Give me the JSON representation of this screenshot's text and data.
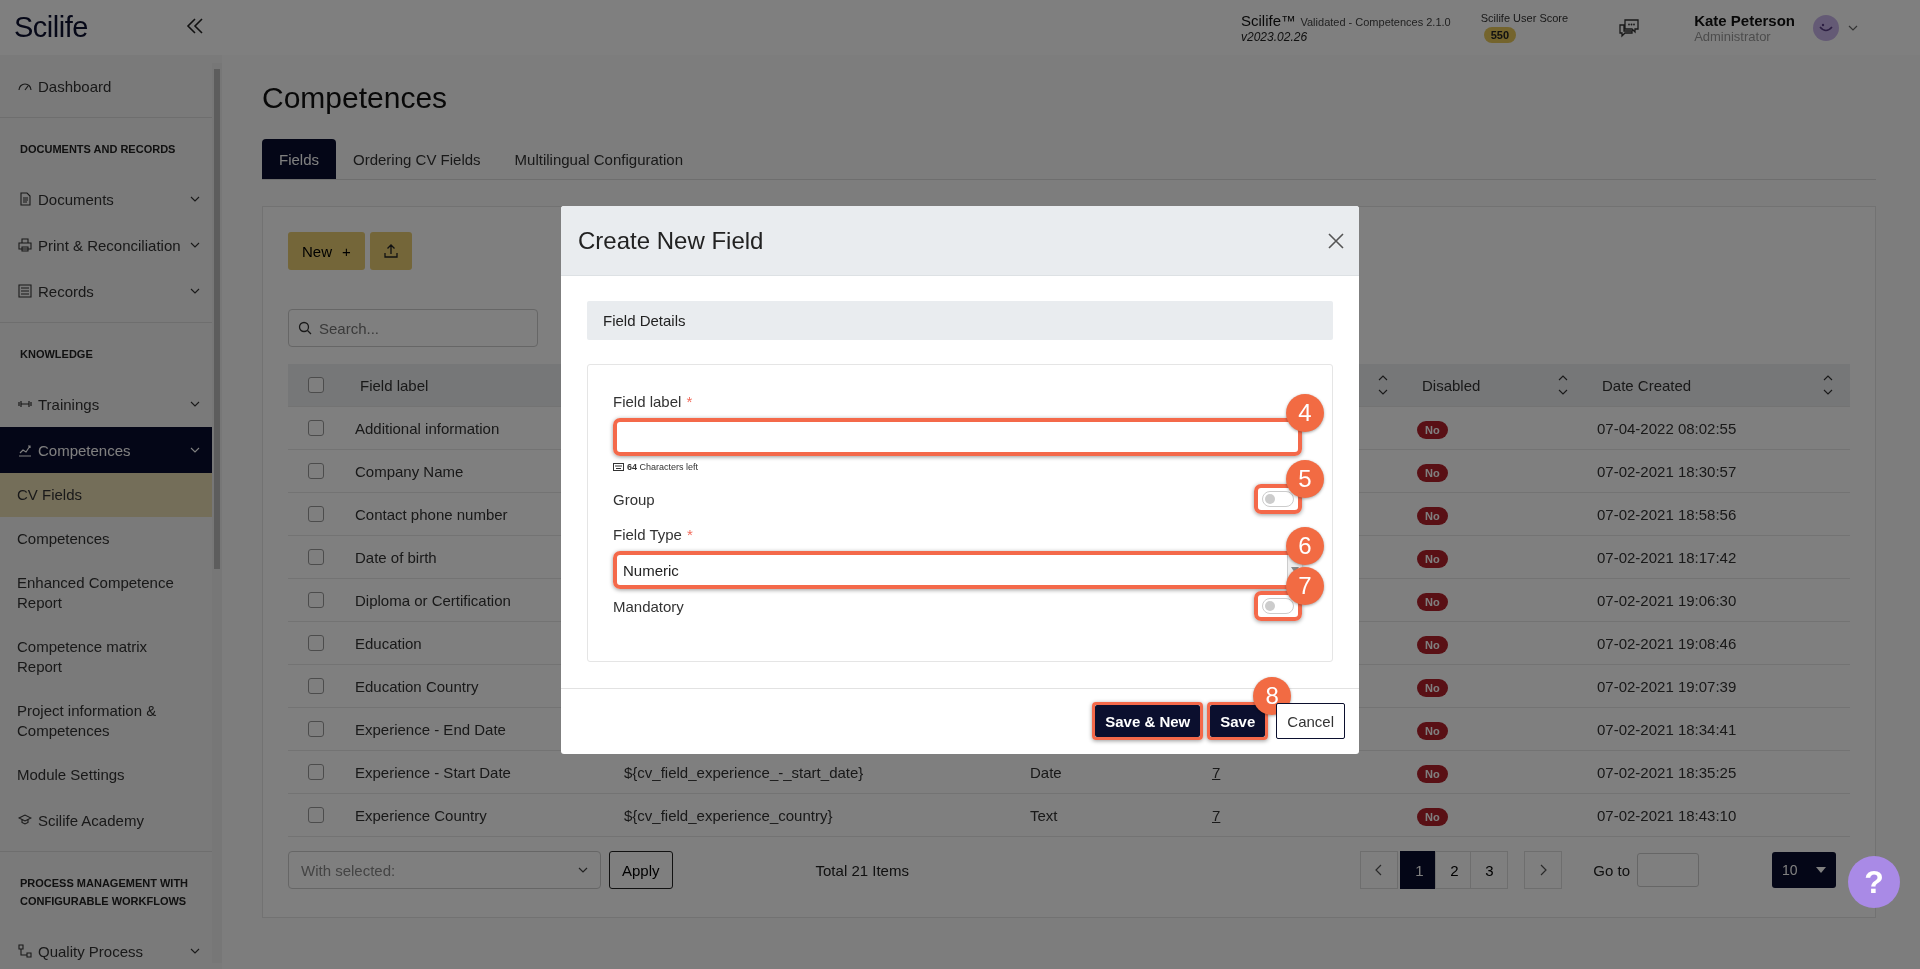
{
  "header": {
    "logo": "Scilife",
    "product": "Scilife™",
    "edition": "Validated - Competences 2.1.0",
    "version": "v2023.02.26",
    "score_label": "Scilife User Score",
    "score": "550",
    "user_name": "Kate Peterson",
    "user_role": "Administrator"
  },
  "sidebar": {
    "items": [
      {
        "kind": "item",
        "label": "Dashboard",
        "selected": false
      },
      {
        "kind": "section",
        "label": "DOCUMENTS AND RECORDS"
      },
      {
        "kind": "menu",
        "label": "Documents",
        "selected": false
      },
      {
        "kind": "menu",
        "label": "Print & Reconciliation",
        "selected": false
      },
      {
        "kind": "menu",
        "label": "Records",
        "selected": false
      },
      {
        "kind": "section",
        "label": "KNOWLEDGE"
      },
      {
        "kind": "menu",
        "label": "Trainings",
        "selected": false
      },
      {
        "kind": "menu",
        "label": "Competences",
        "selected": true,
        "expanded": true,
        "children": [
          {
            "label": "CV Fields",
            "selected": true
          },
          {
            "label": "Competences",
            "selected": false
          },
          {
            "label": "Enhanced Competence Report",
            "selected": false
          },
          {
            "label": "Competence matrix Report",
            "selected": false
          },
          {
            "label": "Project information & Competences",
            "selected": false
          },
          {
            "label": "Module Settings",
            "selected": false
          }
        ]
      },
      {
        "kind": "item",
        "label": "Scilife Academy",
        "selected": false
      },
      {
        "kind": "section",
        "label": "PROCESS MANAGEMENT WITH CONFIGURABLE WORKFLOWS"
      },
      {
        "kind": "menu",
        "label": "Quality Process",
        "selected": false
      }
    ]
  },
  "page": {
    "title": "Competences",
    "tabs": [
      {
        "label": "Fields",
        "selected": true
      },
      {
        "label": "Ordering CV Fields",
        "selected": false
      },
      {
        "label": "Multilingual Configuration",
        "selected": false
      }
    ]
  },
  "toolbar": {
    "new_button": "New",
    "new_icon": "+",
    "search_placeholder": "Search..."
  },
  "table": {
    "select_all": {
      "checked": false
    },
    "columns": [
      {
        "label": "Field label",
        "sortable": false
      },
      {
        "sortable": true
      },
      {
        "label": "Disabled",
        "sortable": true
      },
      {
        "label": "Date Created",
        "sortable": true
      }
    ],
    "rows": [
      {
        "selected": false,
        "field_label": "Additional information",
        "disabled": "No",
        "date_created": "07-04-2022 08:02:55"
      },
      {
        "selected": false,
        "field_label": "Company Name",
        "disabled": "No",
        "date_created": "07-02-2021 18:30:57"
      },
      {
        "selected": false,
        "field_label": "Contact phone number",
        "disabled": "No",
        "date_created": "07-02-2021 18:58:56"
      },
      {
        "selected": false,
        "field_label": "Date of birth",
        "disabled": "No",
        "date_created": "07-02-2021 18:17:42"
      },
      {
        "selected": false,
        "field_label": "Diploma or Certification",
        "disabled": "No",
        "date_created": "07-02-2021 19:06:30"
      },
      {
        "selected": false,
        "field_label": "Education",
        "disabled": "No",
        "date_created": "07-02-2021 19:08:46"
      },
      {
        "selected": false,
        "field_label": "Education Country",
        "disabled": "No",
        "date_created": "07-02-2021 19:07:39"
      },
      {
        "selected": false,
        "field_label": "Experience - End Date",
        "disabled": "No",
        "date_created": "07-02-2021 18:34:41"
      },
      {
        "selected": false,
        "field_label": "Experience - Start Date",
        "column_3": "${cv_field_experience_-_start_date}",
        "column_4": "Date",
        "column_5": "7",
        "disabled": "No",
        "date_created": "07-02-2021 18:35:25"
      },
      {
        "selected": false,
        "field_label": "Experience Country",
        "column_3": "${cv_field_experience_country}",
        "column_4": "Text",
        "column_5": "7",
        "disabled": "No",
        "date_created": "07-02-2021 18:43:10"
      }
    ]
  },
  "footer": {
    "bulk_placeholder": "With selected:",
    "apply": "Apply",
    "total": "Total 21 Items",
    "pages": [
      {
        "label": "1",
        "selected": true
      },
      {
        "label": "2",
        "selected": false
      },
      {
        "label": "3",
        "selected": false
      }
    ],
    "goto_label": "Go to",
    "page_size": "10",
    "help": "?"
  },
  "modal": {
    "title": "Create New Field",
    "section": "Field Details",
    "required_symbol": "*",
    "fields": [
      {
        "kind": "text",
        "label": "Field label",
        "required": true,
        "highlighted": true,
        "callout": "4",
        "hint_count": "64",
        "hint": "Characters left"
      },
      {
        "kind": "toggle",
        "label": "Group",
        "on": false,
        "highlighted": true,
        "callout": "5"
      },
      {
        "kind": "select",
        "label": "Field Type",
        "required": true,
        "value": "Numeric",
        "highlighted": true,
        "callout": "6"
      },
      {
        "kind": "toggle",
        "label": "Mandatory",
        "on": false,
        "highlighted": true,
        "callout": "7"
      }
    ],
    "buttons": [
      {
        "kind": "primary",
        "label": "Save & New",
        "highlighted": true
      },
      {
        "kind": "primary",
        "label": "Save",
        "highlighted": true,
        "callout": "8"
      },
      {
        "kind": "secondary",
        "label": "Cancel",
        "highlighted": false
      }
    ]
  }
}
